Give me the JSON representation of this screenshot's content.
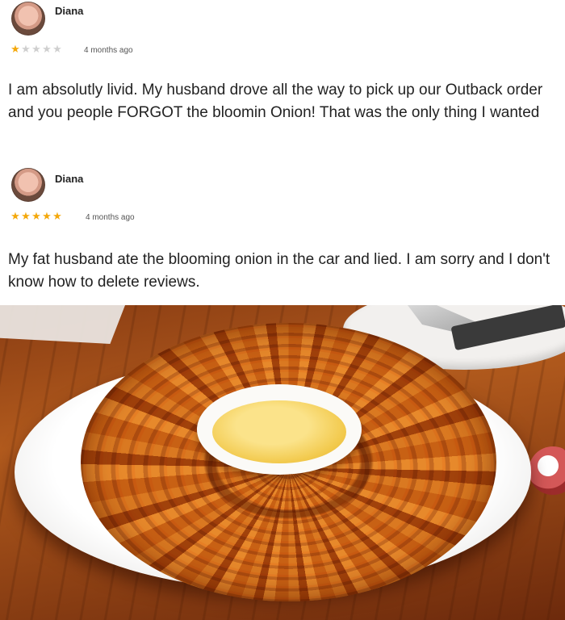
{
  "reviews": [
    {
      "author": "Diana",
      "rating": 1,
      "stars": [
        "★",
        "★",
        "★",
        "★",
        "★"
      ],
      "time": "4 months ago",
      "text": "I am absolutly livid. My husband drove all the way to pick up our Outback order and you people FORGOT the bloomin Onion! That was the only thing I wanted"
    },
    {
      "author": "Diana",
      "rating": 5,
      "stars": [
        "★",
        "★",
        "★",
        "★",
        "★"
      ],
      "time": "4 months ago",
      "text": "My fat husband ate the blooming onion in the car and lied. I am sorry and I don't know how to delete reviews."
    }
  ],
  "photo": {
    "subject": "blooming-onion-icon",
    "colors": {
      "onion": "#c0621c",
      "sauce": "#f2c94c",
      "plate": "#ffffff",
      "table": "#8a3d13"
    }
  }
}
